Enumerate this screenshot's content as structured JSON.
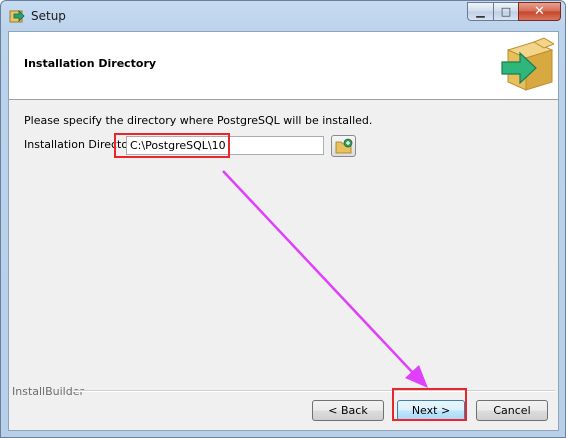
{
  "window": {
    "title": "Setup",
    "title_icon": "installer-arrow-icon",
    "controls": {
      "minimize": "▁",
      "maximize": "□",
      "close": "✕"
    }
  },
  "header": {
    "title": "Installation Directory",
    "logo_icon": "box-arrow-icon"
  },
  "main": {
    "description": "Please specify the directory where PostgreSQL will be installed.",
    "directory_label": "Installation Directory",
    "directory_value": "C:\\PostgreSQL\\10",
    "browse_icon": "folder-browse-icon"
  },
  "footer": {
    "brand": "InstallBuilder",
    "back_label": "< Back",
    "next_label": "Next >",
    "cancel_label": "Cancel"
  },
  "annotations": {
    "highlight_color": "#e8262c",
    "arrow_color": "#e040fb"
  }
}
